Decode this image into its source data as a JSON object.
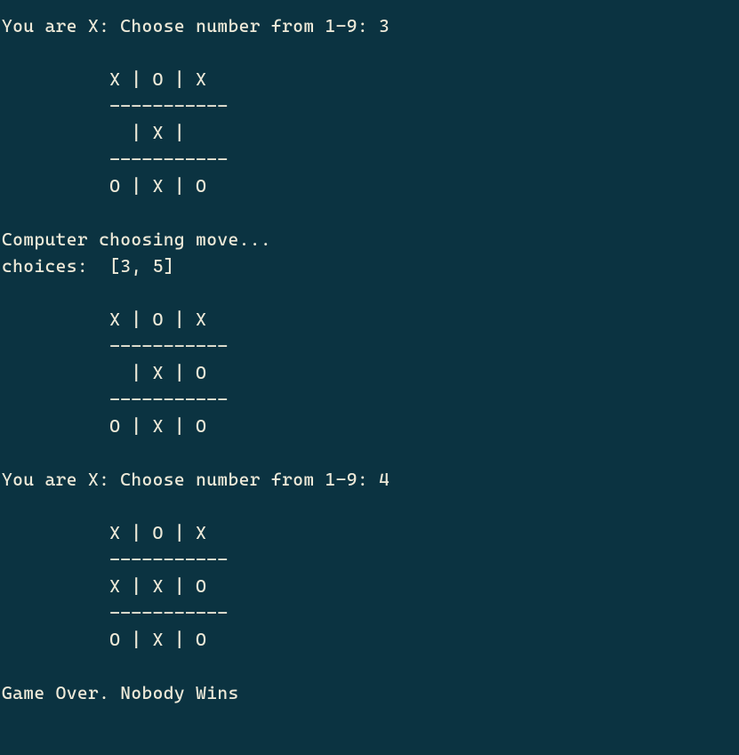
{
  "turns": [
    {
      "prompt": "You are X: Choose number from 1-9: ",
      "input": "3",
      "board": [
        [
          "X",
          "O",
          "X"
        ],
        [
          " ",
          "X",
          " "
        ],
        [
          "O",
          "X",
          "O"
        ]
      ]
    },
    {
      "computer_line": "Computer choosing move...",
      "choices_label": "choices:  ",
      "choices": [
        3,
        5
      ],
      "board": [
        [
          "X",
          "O",
          "X"
        ],
        [
          " ",
          "X",
          "O"
        ],
        [
          "O",
          "X",
          "O"
        ]
      ]
    },
    {
      "prompt": "You are X: Choose number from 1-9: ",
      "input": "4",
      "board": [
        [
          "X",
          "O",
          "X"
        ],
        [
          "X",
          "X",
          "O"
        ],
        [
          "O",
          "X",
          "O"
        ]
      ]
    }
  ],
  "game_over": "Game Over. Nobody Wins",
  "board_layout": {
    "indent": "          ",
    "sep": " | ",
    "hr": "-----------"
  }
}
